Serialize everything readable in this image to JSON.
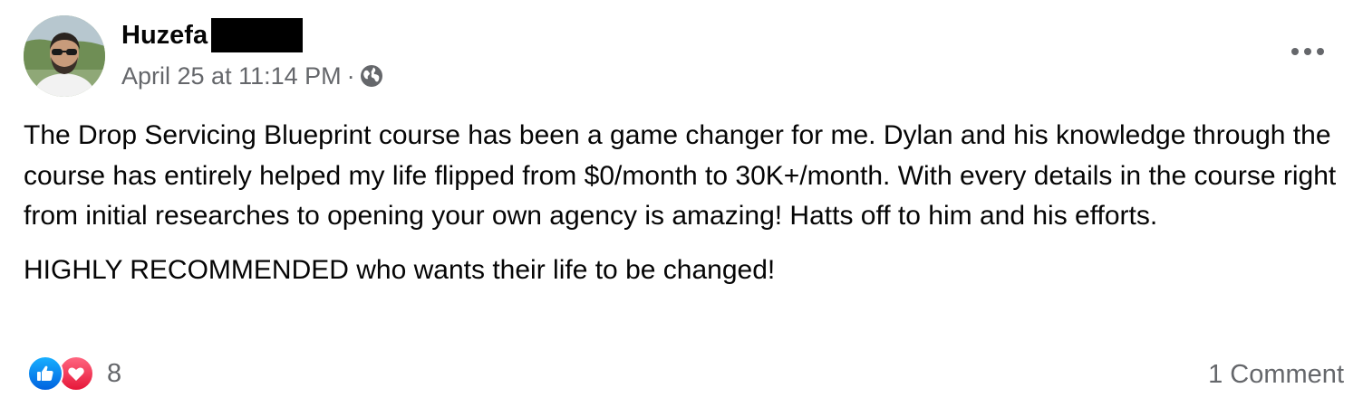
{
  "post": {
    "author_name": "Huzefa",
    "timestamp": "April 25 at 11:14 PM",
    "separator": "·",
    "privacy_icon": "globe-icon",
    "more_icon": "more-options-icon",
    "paragraphs": [
      "The Drop Servicing Blueprint course has been a game changer for me. Dylan and his knowledge through the course has entirely helped my life flipped from $0/month to 30K+/month. With every details in the course right from initial researches to opening your own agency is amazing! Hatts off to him and his efforts.",
      "HIGHLY RECOMMENDED who wants their life to be changed!"
    ]
  },
  "footer": {
    "reactions": [
      "like-icon",
      "love-icon"
    ],
    "reaction_count": "8",
    "comment_count": "1 Comment"
  },
  "colors": {
    "text_primary": "#050505",
    "text_secondary": "#65676b",
    "like_blue": "#1877f2",
    "love_red": "#f33e58"
  }
}
